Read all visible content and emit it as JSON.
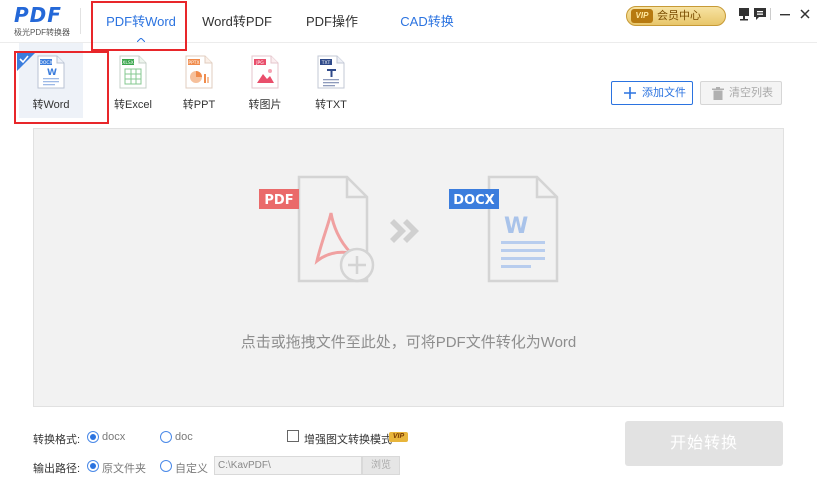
{
  "app": {
    "logo_text": "PDF",
    "logo_subtitle": "极光PDF转换器"
  },
  "nav": {
    "tabs": [
      {
        "label": "PDF转Word",
        "active": true
      },
      {
        "label": "Word转PDF",
        "active": false
      },
      {
        "label": "PDF操作",
        "active": false
      },
      {
        "label": "CAD转换",
        "active": false
      }
    ]
  },
  "header": {
    "vip_badge": "VIP",
    "member_center": "会员中心"
  },
  "toolbar": {
    "tools": [
      {
        "label": "转Word",
        "doc_tag": "DOCX",
        "color": "#3b7ddd",
        "active": true
      },
      {
        "label": "转Excel",
        "doc_tag": "XLSX",
        "color": "#3aa64d",
        "active": false
      },
      {
        "label": "转PPT",
        "doc_tag": "PPTX",
        "color": "#f08b4b",
        "active": false
      },
      {
        "label": "转图片",
        "doc_tag": "JPG",
        "color": "#e94e6b",
        "active": false
      },
      {
        "label": "转TXT",
        "doc_tag": "TXT",
        "color": "#2f4a8a",
        "active": false
      }
    ],
    "add_file": "添加文件",
    "clear_list": "清空列表"
  },
  "dropzone": {
    "source_tag": "PDF",
    "target_tag": "DOCX",
    "hint": "点击或拖拽文件至此处，可将PDF文件转化为Word"
  },
  "options": {
    "format_label": "转换格式:",
    "format_options": [
      {
        "label": "docx",
        "selected": true
      },
      {
        "label": "doc",
        "selected": false
      }
    ],
    "enhance_label": "增强图文转换模式",
    "enhance_vip": "VIP",
    "enhance_checked": false,
    "output_label": "输出路径:",
    "output_options": [
      {
        "label": "原文件夹",
        "selected": true
      },
      {
        "label": "自定义",
        "selected": false
      }
    ],
    "custom_path": "C:\\KavPDF\\",
    "browse": "浏览",
    "start": "开始转换"
  },
  "colors": {
    "accent": "#2b73e0",
    "highlight": "#e8262a",
    "pdf_red": "#e94e54",
    "docx_blue": "#3b7ddd"
  },
  "icons": {
    "minimize": "minimize-icon",
    "close": "close-icon",
    "skin": "skin-icon",
    "message": "message-icon"
  }
}
